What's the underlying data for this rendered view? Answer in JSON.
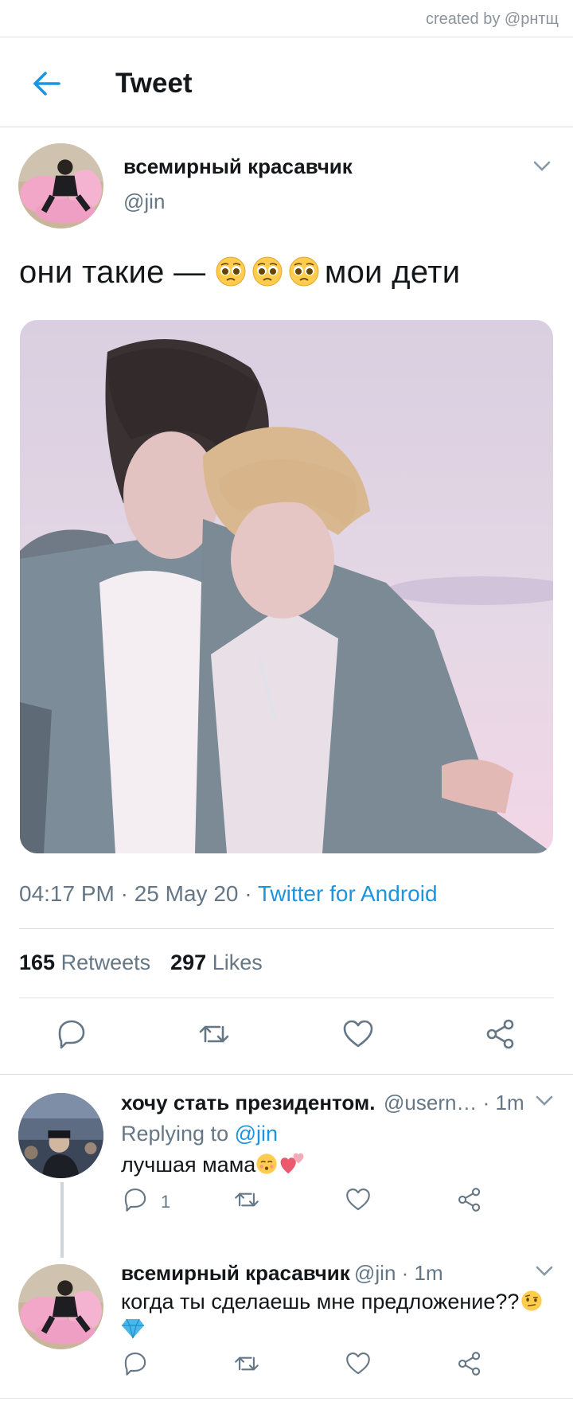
{
  "credit": "created by @рнтщ",
  "header": {
    "title": "Tweet"
  },
  "tweet": {
    "author_name": "всемирный красавчик",
    "author_handle": "@jin",
    "text_before": "они такие — ",
    "text_after": "мои дети",
    "emojis": [
      "pleading-face",
      "pleading-face",
      "pleading-face"
    ],
    "time": "04:17 PM · 25 May 20 · ",
    "source": "Twitter for Android",
    "retweets_count": "165",
    "retweets_label": "Retweets",
    "likes_count": "297",
    "likes_label": "Likes"
  },
  "replies": [
    {
      "name": "хочу стать президентом.",
      "handle": "@usern… · 1m",
      "replying_prefix": "Replying to ",
      "replying_to": "@jin",
      "text": "лучшая мама",
      "emojis": [
        "kissing-face",
        "two-hearts"
      ],
      "reply_count": "1"
    },
    {
      "name": "всемирный красавчик",
      "handle": "@jin · 1m",
      "text": "когда ты сделаешь мне предложение??",
      "emojis": [
        "raised-eyebrow-face",
        "gem"
      ]
    }
  ],
  "colors": {
    "accent": "#1b95e0",
    "secondary_text": "#657786",
    "divider": "#e1e4e6"
  }
}
